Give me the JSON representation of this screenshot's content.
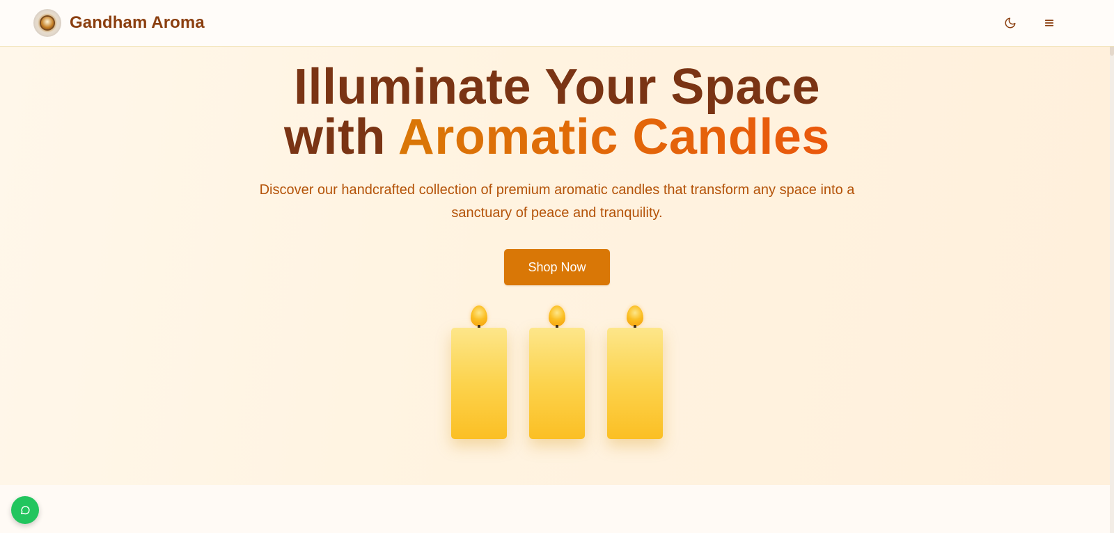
{
  "header": {
    "brand_name": "Gandham Aroma",
    "logo_icon": "brand-seal-logo",
    "theme_toggle_icon": "moon-icon",
    "menu_icon": "hamburger-menu-icon"
  },
  "hero": {
    "title_line1": "Illuminate Your Space",
    "title_line2_prefix": "with ",
    "title_line2_accent": "Aromatic Candles",
    "subtitle": "Discover our handcrafted collection of premium aromatic candles that transform any space into a sanctuary of peace and tranquility.",
    "cta_label": "Shop Now"
  },
  "colors": {
    "brand": "#8b3f10",
    "title": "#7a3414",
    "accent_start": "#d97706",
    "accent_end": "#ea580c",
    "subtitle": "#b45309",
    "button": "#d97706",
    "candle": "#fcd34d",
    "chat": "#22c55e"
  },
  "chat_widget": {
    "icon": "chat-bubble-icon"
  }
}
